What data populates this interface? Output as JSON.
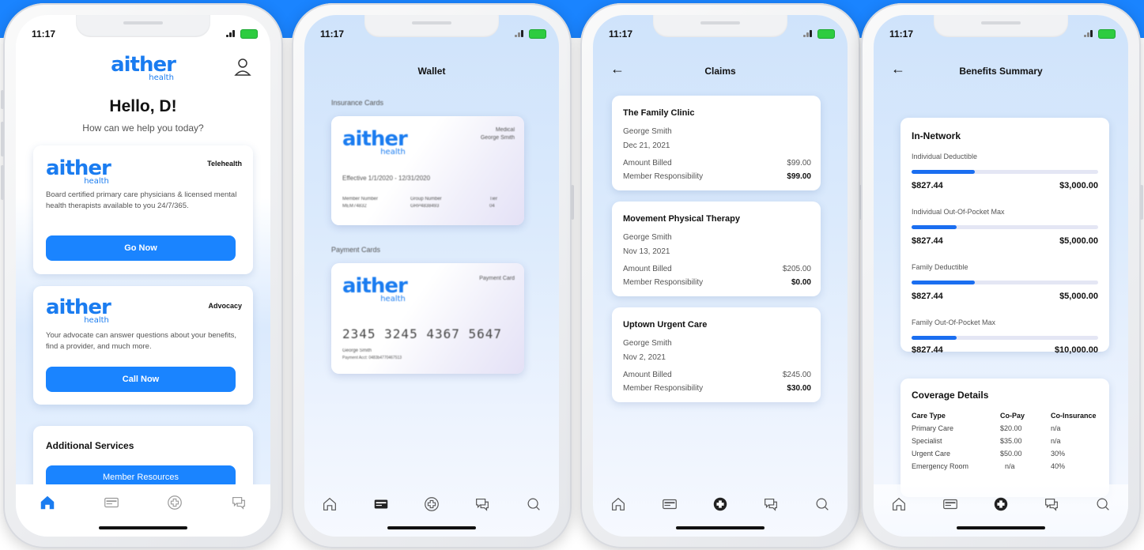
{
  "status": {
    "time": "11:17"
  },
  "colors": {
    "accent": "#1a84ff",
    "band": "#1a84ff"
  },
  "logo": {
    "word": "aither",
    "sub": "health"
  },
  "home": {
    "greeting": "Hello, D!",
    "subtitle": "How can we help you today?",
    "telehealth": {
      "tag": "Telehealth",
      "text": "Board certified primary care physicians & licensed mental health therapists available to you 24/7/365.",
      "button": "Go Now"
    },
    "advocacy": {
      "tag": "Advocacy",
      "text": "Your advocate can answer questions about your benefits, find a provider, and much more.",
      "button": "Call Now"
    },
    "additional": {
      "title": "Additional Services",
      "button": "Member Resources"
    }
  },
  "wallet": {
    "title": "Wallet",
    "insurance_label": "Insurance Cards",
    "insurance_card": {
      "type": "Medical",
      "holder": "George Smith",
      "effective": "Effective 1/1/2020 - 12/31/2020",
      "col1_label": "Member Number",
      "col1_value": "MEM74832",
      "col2_label": "Group Number",
      "col2_value": "GRP4838493",
      "col3_label": "Tier",
      "col3_value": "04"
    },
    "payment_label": "Payment Cards",
    "payment_card": {
      "type": "Payment Card",
      "number": "2345 3245 4367 5647",
      "holder": "George Smith",
      "detail": "Payment Acct: 0483b4770467513"
    }
  },
  "claims": {
    "title": "Claims",
    "items": [
      {
        "name": "The Family Clinic",
        "patient": "George Smith",
        "date": "Dec 21, 2021",
        "billed_label": "Amount Billed",
        "billed": "$99.00",
        "resp_label": "Member Responsibility",
        "resp": "$99.00"
      },
      {
        "name": "Movement Physical Therapy",
        "patient": "George Smith",
        "date": "Nov 13, 2021",
        "billed_label": "Amount Billed",
        "billed": "$205.00",
        "resp_label": "Member Responsibility",
        "resp": "$0.00"
      },
      {
        "name": "Uptown Urgent Care",
        "patient": "George Smith",
        "date": "Nov 2, 2021",
        "billed_label": "Amount Billed",
        "billed": "$245.00",
        "resp_label": "Member Responsibility",
        "resp": "$30.00"
      }
    ]
  },
  "benefits": {
    "title": "Benefits Summary",
    "section": "In-Network",
    "items": [
      {
        "label": "Individual Deductible",
        "value": "$827.44",
        "max": "$3,000.00",
        "fraction": 0.34
      },
      {
        "label": "Individual Out-Of-Pocket Max",
        "value": "$827.44",
        "max": "$5,000.00",
        "fraction": 0.24
      },
      {
        "label": "Family Deductible",
        "value": "$827.44",
        "max": "$5,000.00",
        "fraction": 0.34
      },
      {
        "label": "Family Out-Of-Pocket Max",
        "value": "$827.44",
        "max": "$10,000.00",
        "fraction": 0.24
      }
    ],
    "coverage": {
      "title": "Coverage Details",
      "headers": [
        "Care Type",
        "Co-Pay",
        "Co-Insurance"
      ],
      "rows": [
        [
          "Primary Care",
          "$20.00",
          "n/a"
        ],
        [
          "Specialist",
          "$35.00",
          "n/a"
        ],
        [
          "Urgent Care",
          "$50.00",
          "30%"
        ],
        [
          "Emergency Room",
          "n/a",
          "40%"
        ]
      ]
    }
  },
  "tabs": [
    "home-icon",
    "wallet-card-icon",
    "medical-cross-icon",
    "chat-icon",
    "search-icon"
  ]
}
